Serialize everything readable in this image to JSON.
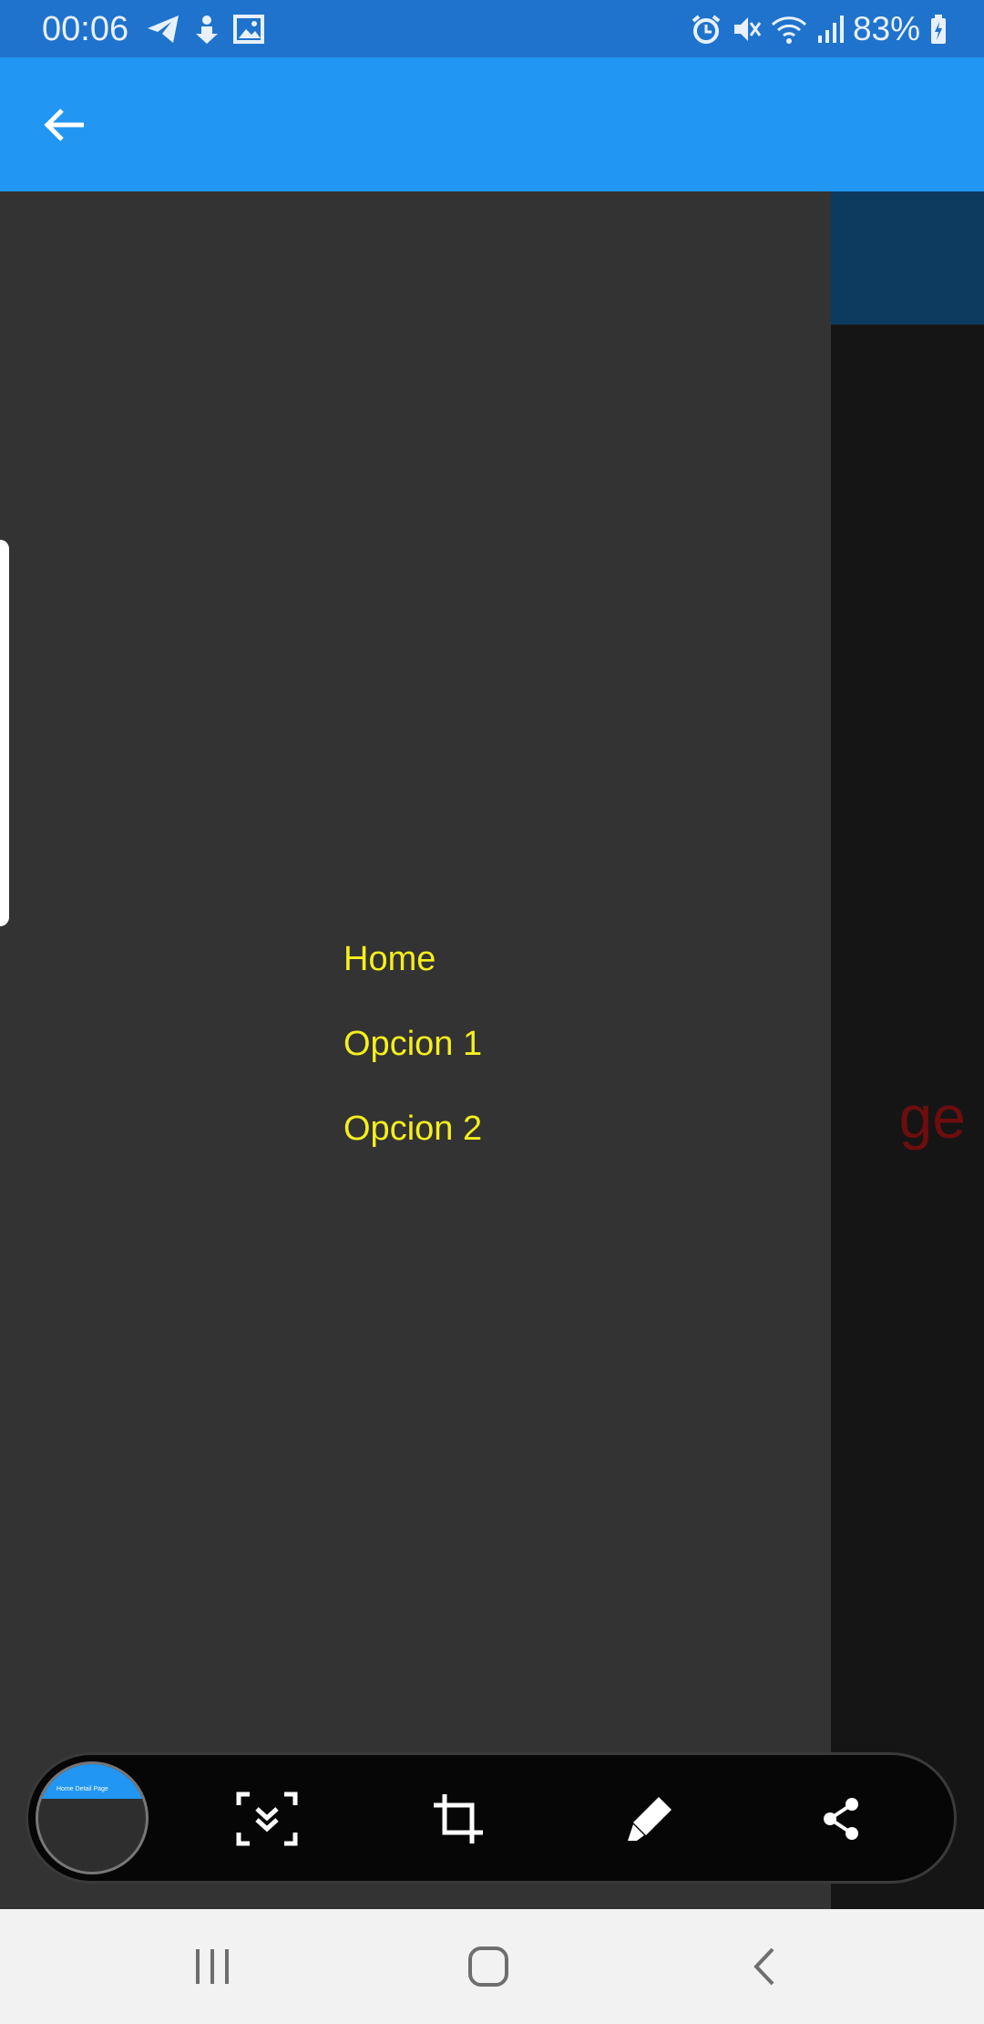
{
  "status_bar": {
    "time": "00:06",
    "battery": "83%",
    "left_icons": [
      "telegram-icon",
      "download-icon",
      "gallery-icon"
    ],
    "right_icons": [
      "alarm-icon",
      "vibrate-icon",
      "wifi-icon",
      "signal-icon",
      "battery-charging-icon"
    ]
  },
  "app_bar": {
    "back_icon": "arrow-back-icon",
    "color": "#2196f3"
  },
  "background_page": {
    "title_fragment": "ge",
    "title_color": "#6e0d0d"
  },
  "drawer": {
    "items": [
      {
        "label": "Home"
      },
      {
        "label": "Opcion 1"
      },
      {
        "label": "Opcion 2"
      }
    ],
    "item_color": "#f5ef1e",
    "background": "#333333"
  },
  "capture_toolbar": {
    "thumbnail_title": "Home Detail Page",
    "tools": [
      "scroll-capture-icon",
      "crop-icon",
      "draw-icon",
      "share-icon"
    ]
  },
  "nav_bar": {
    "buttons": [
      "recent-apps-icon",
      "home-icon",
      "back-icon"
    ]
  }
}
